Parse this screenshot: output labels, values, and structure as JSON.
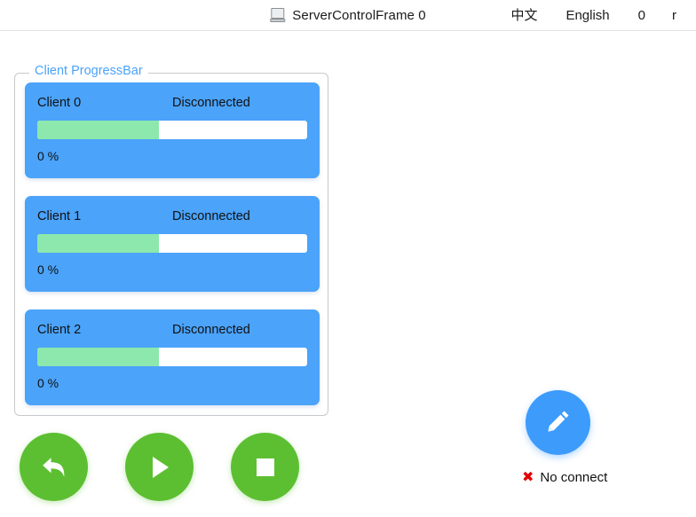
{
  "window": {
    "title": "ServerControlFrame 0",
    "icon": "computer-icon"
  },
  "header": {
    "lang_cn": "中文",
    "lang_en": "English",
    "counter": "0",
    "trailing": "r"
  },
  "group": {
    "title": "Client ProgressBar"
  },
  "clients": [
    {
      "name": "Client 0",
      "status": "Disconnected",
      "percent_label": "0 %",
      "fill_percent": 45
    },
    {
      "name": "Client 1",
      "status": "Disconnected",
      "percent_label": "0 %",
      "fill_percent": 45
    },
    {
      "name": "Client 2",
      "status": "Disconnected",
      "percent_label": "0 %",
      "fill_percent": 45
    }
  ],
  "actions": [
    {
      "name": "undo-button",
      "icon": "reply-arrow-icon"
    },
    {
      "name": "play-button",
      "icon": "play-icon"
    },
    {
      "name": "stop-button",
      "icon": "stop-icon"
    }
  ],
  "edit_button": {
    "icon": "pencil-icon"
  },
  "connection": {
    "mark": "✖",
    "text": "No connect"
  },
  "colors": {
    "card_blue": "#4ba3fa",
    "fab_blue": "#3d9bfc",
    "progress_green": "#8ce8ac",
    "button_green": "#5cbf32",
    "error_red": "#e00000",
    "background": "#ffffff"
  }
}
